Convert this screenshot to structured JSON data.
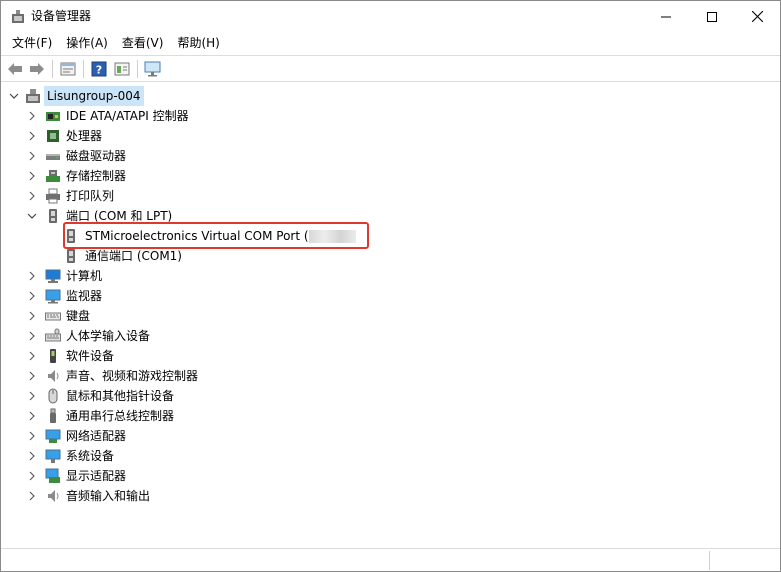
{
  "window": {
    "title": "设备管理器",
    "controls": {
      "minimize": "—",
      "maximize": "□",
      "close": "✕"
    }
  },
  "menu": [
    "文件(F)",
    "操作(A)",
    "查看(V)",
    "帮助(H)"
  ],
  "toolbar": [
    "back-arrow-icon",
    "forward-arrow-icon",
    "properties-icon",
    "help-icon",
    "view-icon",
    "monitor-scan-icon"
  ],
  "tree": {
    "root": "Lisungroup-004",
    "categories": [
      {
        "label": "IDE ATA/ATAPI 控制器",
        "icon": "ide-controller-icon",
        "expanded": false
      },
      {
        "label": "处理器",
        "icon": "processor-icon",
        "expanded": false
      },
      {
        "label": "磁盘驱动器",
        "icon": "disk-drive-icon",
        "expanded": false
      },
      {
        "label": "存储控制器",
        "icon": "storage-controller-icon",
        "expanded": false
      },
      {
        "label": "打印队列",
        "icon": "printer-icon",
        "expanded": false
      },
      {
        "label": "端口 (COM 和 LPT)",
        "icon": "port-icon",
        "expanded": true,
        "children": [
          "STMicroelectronics Virtual COM Port (",
          "通信端口 (COM1)"
        ]
      },
      {
        "label": "计算机",
        "icon": "computer-icon",
        "expanded": false
      },
      {
        "label": "监视器",
        "icon": "monitor-icon",
        "expanded": false
      },
      {
        "label": "键盘",
        "icon": "keyboard-icon",
        "expanded": false
      },
      {
        "label": "人体学输入设备",
        "icon": "hid-icon",
        "expanded": false
      },
      {
        "label": "软件设备",
        "icon": "software-device-icon",
        "expanded": false
      },
      {
        "label": "声音、视频和游戏控制器",
        "icon": "speaker-icon",
        "expanded": false
      },
      {
        "label": "鼠标和其他指针设备",
        "icon": "mouse-icon",
        "expanded": false
      },
      {
        "label": "通用串行总线控制器",
        "icon": "usb-icon",
        "expanded": false
      },
      {
        "label": "网络适配器",
        "icon": "network-adapter-icon",
        "expanded": false
      },
      {
        "label": "系统设备",
        "icon": "system-device-icon",
        "expanded": false
      },
      {
        "label": "显示适配器",
        "icon": "display-adapter-icon",
        "expanded": false
      },
      {
        "label": "音频输入和输出",
        "icon": "audio-io-icon",
        "expanded": false
      }
    ]
  },
  "colors": {
    "selection": "#cce4f7",
    "highlight_box": "#e0382f",
    "accent_blue": "#1e7bd6"
  }
}
